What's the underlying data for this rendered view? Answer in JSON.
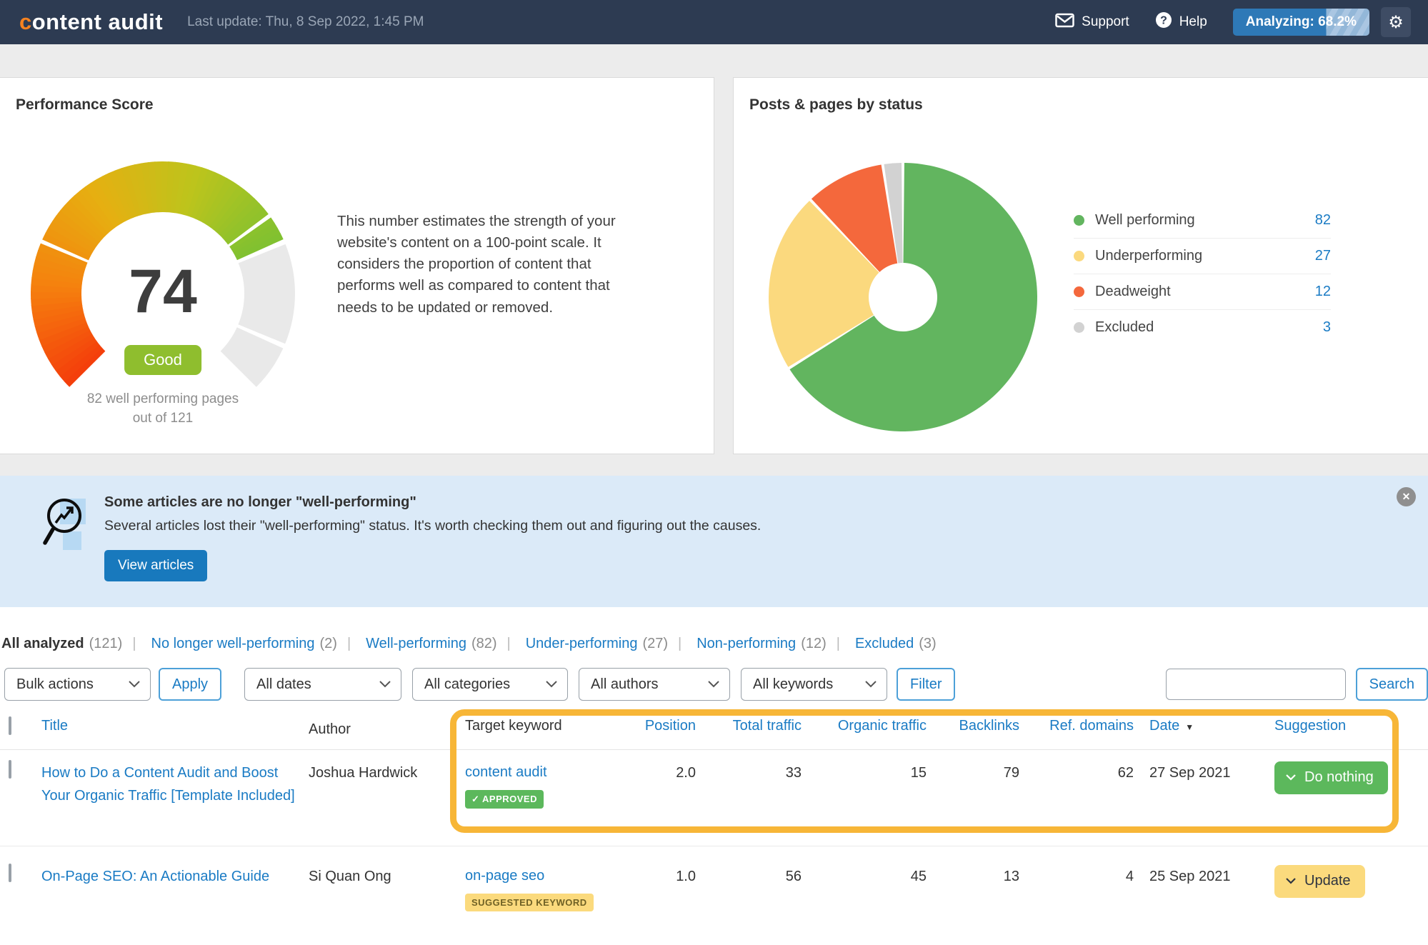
{
  "navbar": {
    "logo_first_letter": "c",
    "logo_rest": "ontent audit",
    "last_update": "Last update: Thu, 8 Sep 2022, 1:45 PM",
    "support_label": "Support",
    "help_label": "Help",
    "analyzing_label": "Analyzing: 68.2%",
    "analyzing_percent": 68.2
  },
  "icons": {
    "gear": "⚙",
    "close": "✕",
    "sort_desc": "▼"
  },
  "performance": {
    "title": "Performance Score",
    "score": "74",
    "badge": "Good",
    "caption_line1": "82 well performing pages",
    "caption_line2": "out of 121",
    "description": "This number estimates the strength of your website's content on a 100-point scale. It considers the proportion of content that performs well as compared to content that needs to be updated or removed."
  },
  "status_panel": {
    "title": "Posts & pages by status",
    "legend": [
      {
        "label": "Well performing",
        "value": 82,
        "color": "#62b55f"
      },
      {
        "label": "Underperforming",
        "value": 27,
        "color": "#fbd97e"
      },
      {
        "label": "Deadweight",
        "value": 12,
        "color": "#f4683c"
      },
      {
        "label": "Excluded",
        "value": 3,
        "color": "#d2d2d2"
      }
    ]
  },
  "chart_data": [
    {
      "type": "gauge",
      "title": "Performance Score",
      "value": 74,
      "max": 100,
      "label": "Good",
      "color_stops": [
        "#f43d0b",
        "#f5820e",
        "#e6af11",
        "#bdc41c",
        "#7fc131"
      ],
      "track_color": "#e9e9e9"
    },
    {
      "type": "pie",
      "title": "Posts & pages by status",
      "categories": [
        "Well performing",
        "Underperforming",
        "Deadweight",
        "Excluded"
      ],
      "values": [
        82,
        27,
        12,
        3
      ],
      "colors": [
        "#62b55f",
        "#fbd97e",
        "#f4683c",
        "#d2d2d2"
      ],
      "donut_hole": 0.25,
      "legend_position": "right"
    }
  ],
  "banner": {
    "title": "Some articles are no longer \"well-performing\"",
    "body": "Several articles lost their \"well-performing\" status. It's worth checking them out and figuring out the causes.",
    "button": "View articles"
  },
  "filters": {
    "tabs": [
      {
        "label": "All analyzed",
        "count": "(121)",
        "active": true
      },
      {
        "label": "No longer well-performing",
        "count": "(2)"
      },
      {
        "label": "Well-performing",
        "count": "(82)"
      },
      {
        "label": "Under-performing",
        "count": "(27)"
      },
      {
        "label": "Non-performing",
        "count": "(12)"
      },
      {
        "label": "Excluded",
        "count": "(3)"
      }
    ]
  },
  "toolbar": {
    "bulk_actions": "Bulk actions",
    "apply": "Apply",
    "all_dates": "All dates",
    "all_categories": "All categories",
    "all_authors": "All authors",
    "all_keywords": "All keywords",
    "filter": "Filter",
    "search": "Search",
    "search_value": ""
  },
  "table": {
    "headers": {
      "title": "Title",
      "author": "Author",
      "target_keyword": "Target keyword",
      "position": "Position",
      "total_traffic": "Total traffic",
      "organic_traffic": "Organic traffic",
      "backlinks": "Backlinks",
      "ref_domains": "Ref. domains",
      "date": "Date",
      "suggestion": "Suggestion"
    },
    "rows": [
      {
        "title": "How to Do a Content Audit and Boost Your Organic Traffic [Template Included]",
        "author": "Joshua Hardwick",
        "keyword": "content audit",
        "keyword_badge": "✓ APPROVED",
        "position": "2.0",
        "total_traffic": "33",
        "organic_traffic": "15",
        "backlinks": "79",
        "ref_domains": "62",
        "date": "27 Sep 2021",
        "suggestion": "Do nothing"
      },
      {
        "title": "On-Page SEO: An Actionable Guide",
        "author": "Si Quan Ong",
        "keyword": "on-page seo",
        "keyword_badge": "SUGGESTED KEYWORD",
        "position": "1.0",
        "total_traffic": "56",
        "organic_traffic": "45",
        "backlinks": "13",
        "ref_domains": "4",
        "date": "25 Sep 2021",
        "suggestion": "Update"
      }
    ]
  }
}
